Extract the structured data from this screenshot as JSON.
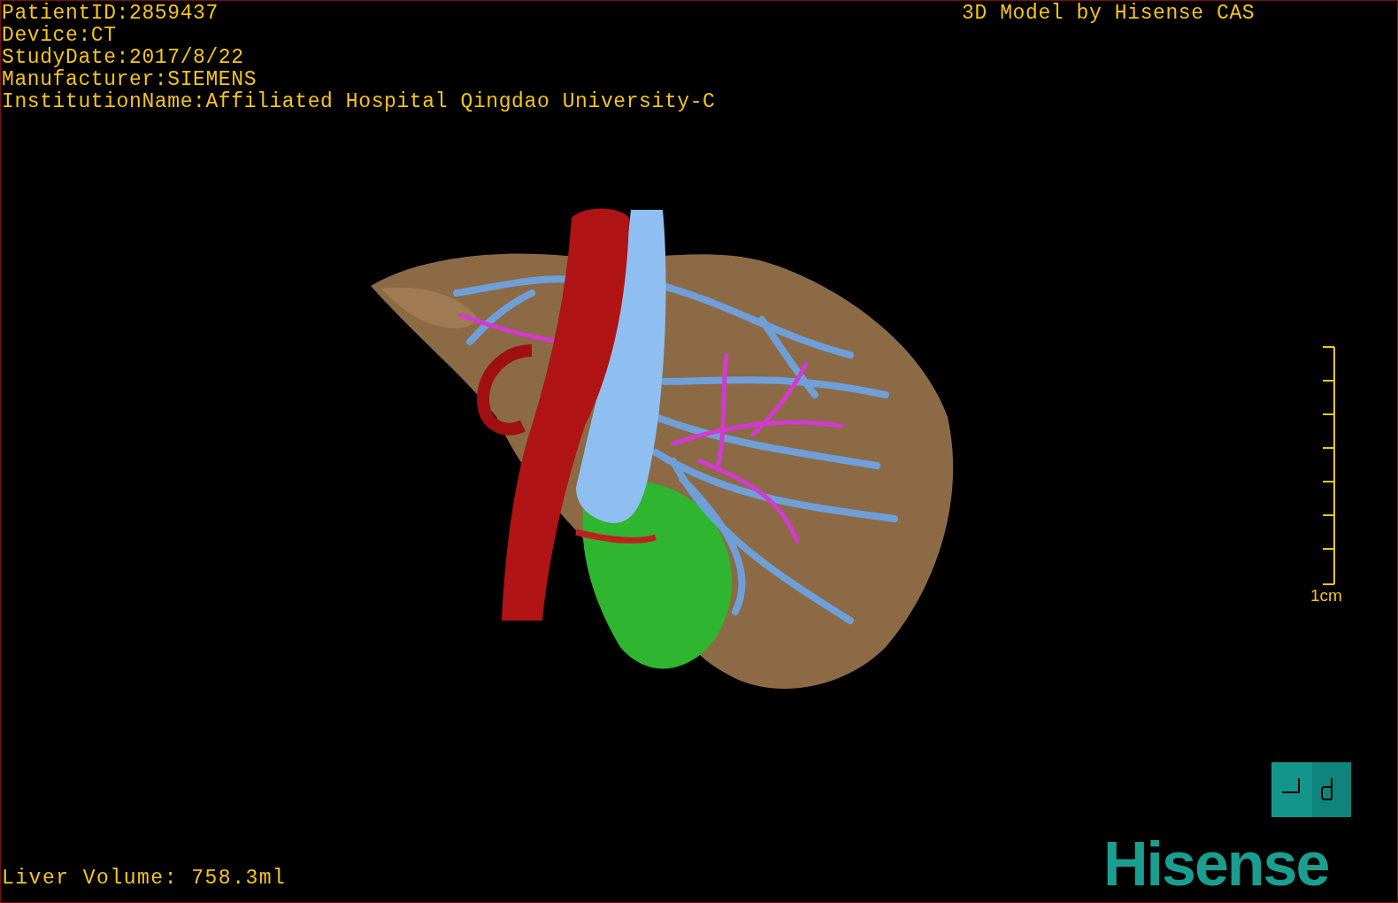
{
  "patient_info": [
    "PatientID:2859437",
    "Device:CT",
    "StudyDate:2017/8/22",
    "Manufacturer:SIEMENS",
    "InstitutionName:Affiliated Hospital Qingdao University-C"
  ],
  "caption": "3D Model by Hisense CAS",
  "scale_bar": {
    "label": "1cm"
  },
  "measurement": "Liver Volume: 758.3ml",
  "logo": "Hisense"
}
